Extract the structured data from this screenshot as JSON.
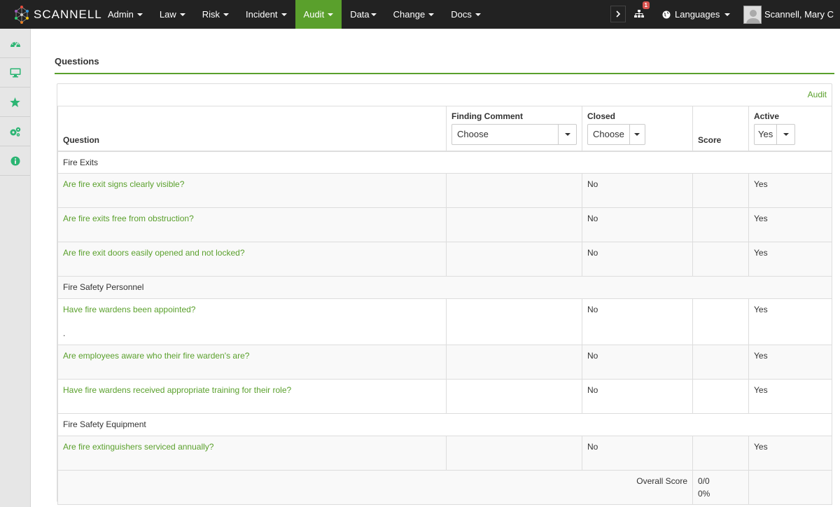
{
  "app": {
    "logo_text": "SCANNELL"
  },
  "nav": {
    "items": [
      {
        "label": "Admin",
        "active": false
      },
      {
        "label": "Law",
        "active": false
      },
      {
        "label": "Risk",
        "active": false
      },
      {
        "label": "Incident",
        "active": false
      },
      {
        "label": "Audit",
        "active": true
      },
      {
        "label": "Data",
        "active": false
      },
      {
        "label": "Change",
        "active": false
      },
      {
        "label": "Docs",
        "active": false
      }
    ],
    "notification_count": "1",
    "languages_label": "Languages",
    "user_name": "Scannell, Mary C"
  },
  "sidebar": {
    "icons": [
      "dashboard-icon",
      "monitor-icon",
      "star-icon",
      "cogs-icon",
      "info-icon"
    ]
  },
  "page": {
    "section_title": "Questions",
    "audit_link": "Audit"
  },
  "table": {
    "headers": {
      "question": "Question",
      "finding_comment": "Finding Comment",
      "closed": "Closed",
      "score": "Score",
      "active": "Active"
    },
    "filters": {
      "finding_comment": "Choose",
      "closed": "Choose",
      "active": "Yes"
    },
    "groups": [
      {
        "name": "Fire Exits",
        "questions": [
          {
            "text": "Are fire exit signs clearly visible?",
            "closed": "No",
            "active": "Yes"
          },
          {
            "text": "Are fire exits free from obstruction?",
            "closed": "No",
            "active": "Yes"
          },
          {
            "text": "Are fire exit doors easily opened and not locked?",
            "closed": "No",
            "active": "Yes"
          }
        ]
      },
      {
        "name": "Fire Safety Personnel",
        "questions": [
          {
            "text": "Have fire wardens been appointed?",
            "note": ".",
            "closed": "No",
            "active": "Yes"
          },
          {
            "text": "Are employees aware who their fire warden's are?",
            "closed": "No",
            "active": "Yes"
          },
          {
            "text": "Have fire wardens received appropriate training for their role?",
            "closed": "No",
            "active": "Yes"
          }
        ]
      },
      {
        "name": "Fire Safety Equipment",
        "questions": [
          {
            "text": "Are fire extinguishers serviced annually?",
            "closed": "No",
            "active": "Yes"
          }
        ]
      }
    ],
    "footer": {
      "label": "Overall Score",
      "score": "0/0",
      "percent": "0%"
    }
  }
}
